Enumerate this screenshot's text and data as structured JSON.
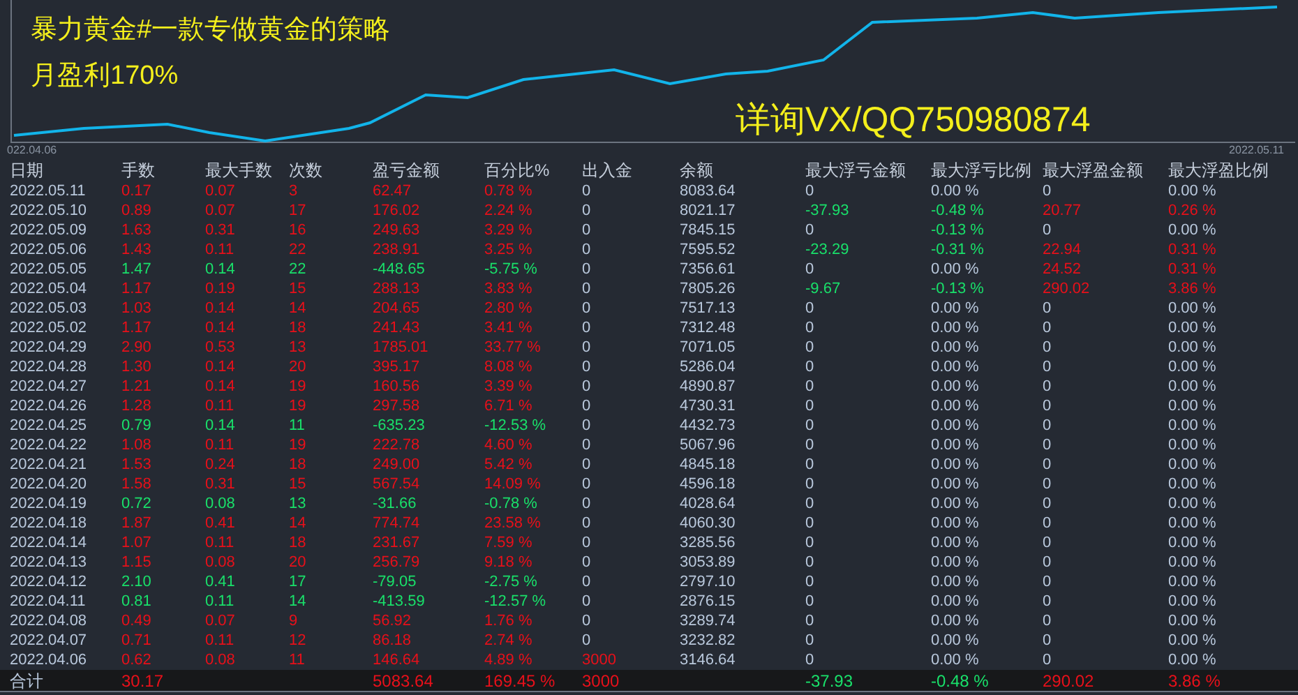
{
  "chart": {
    "title": "暴力黄金#一款专做黄金的策略",
    "subtitle": "月盈利170%",
    "contact": "详询VX/QQ750980874",
    "start_label": "022.04.06",
    "end_label": "2022.05.11"
  },
  "table": {
    "columns": [
      "日期",
      "手数",
      "最大手数",
      "次数",
      "盈亏金额",
      "百分比%",
      "出入金",
      "余额",
      "最大浮亏金额",
      "最大浮亏比例",
      "最大浮盈金额",
      "最大浮盈比例"
    ],
    "rows": [
      {
        "date": "2022.05.11",
        "color": "#e8101a",
        "lots": "0.17",
        "max_lots": "0.07",
        "trades": "3",
        "pnl": "62.47",
        "pct": "0.78 %",
        "cash_flow": {
          "text": "0",
          "color": "#b9c8dc"
        },
        "balance": "8083.64",
        "floats": [
          {
            "text": "0",
            "color": "#b9c8dc"
          },
          {
            "text": "0.00 %",
            "color": "#b9c8dc"
          },
          {
            "text": "0",
            "color": "#b9c8dc"
          },
          {
            "text": "0.00 %",
            "color": "#b9c8dc"
          }
        ]
      },
      {
        "date": "2022.05.10",
        "color": "#e8101a",
        "lots": "0.89",
        "max_lots": "0.07",
        "trades": "17",
        "pnl": "176.02",
        "pct": "2.24 %",
        "cash_flow": {
          "text": "0",
          "color": "#b9c8dc"
        },
        "balance": "8021.17",
        "floats": [
          {
            "text": "-37.93",
            "color": "#19e06a"
          },
          {
            "text": "-0.48 %",
            "color": "#19e06a"
          },
          {
            "text": "20.77",
            "color": "#e8101a"
          },
          {
            "text": "0.26 %",
            "color": "#e8101a"
          }
        ]
      },
      {
        "date": "2022.05.09",
        "color": "#e8101a",
        "lots": "1.63",
        "max_lots": "0.31",
        "trades": "16",
        "pnl": "249.63",
        "pct": "3.29 %",
        "cash_flow": {
          "text": "0",
          "color": "#b9c8dc"
        },
        "balance": "7845.15",
        "floats": [
          {
            "text": "0",
            "color": "#b9c8dc"
          },
          {
            "text": "-0.13 %",
            "color": "#19e06a"
          },
          {
            "text": "0",
            "color": "#b9c8dc"
          },
          {
            "text": "0.00 %",
            "color": "#b9c8dc"
          }
        ]
      },
      {
        "date": "2022.05.06",
        "color": "#e8101a",
        "lots": "1.43",
        "max_lots": "0.11",
        "trades": "22",
        "pnl": "238.91",
        "pct": "3.25 %",
        "cash_flow": {
          "text": "0",
          "color": "#b9c8dc"
        },
        "balance": "7595.52",
        "floats": [
          {
            "text": "-23.29",
            "color": "#19e06a"
          },
          {
            "text": "-0.31 %",
            "color": "#19e06a"
          },
          {
            "text": "22.94",
            "color": "#e8101a"
          },
          {
            "text": "0.31 %",
            "color": "#e8101a"
          }
        ]
      },
      {
        "date": "2022.05.05",
        "color": "#19e06a",
        "lots": "1.47",
        "max_lots": "0.14",
        "trades": "22",
        "pnl": "-448.65",
        "pct": "-5.75 %",
        "cash_flow": {
          "text": "0",
          "color": "#b9c8dc"
        },
        "balance": "7356.61",
        "floats": [
          {
            "text": "0",
            "color": "#b9c8dc"
          },
          {
            "text": "0.00 %",
            "color": "#b9c8dc"
          },
          {
            "text": "24.52",
            "color": "#e8101a"
          },
          {
            "text": "0.31 %",
            "color": "#e8101a"
          }
        ]
      },
      {
        "date": "2022.05.04",
        "color": "#e8101a",
        "lots": "1.17",
        "max_lots": "0.19",
        "trades": "15",
        "pnl": "288.13",
        "pct": "3.83 %",
        "cash_flow": {
          "text": "0",
          "color": "#b9c8dc"
        },
        "balance": "7805.26",
        "floats": [
          {
            "text": "-9.67",
            "color": "#19e06a"
          },
          {
            "text": "-0.13 %",
            "color": "#19e06a"
          },
          {
            "text": "290.02",
            "color": "#e8101a"
          },
          {
            "text": "3.86 %",
            "color": "#e8101a"
          }
        ]
      },
      {
        "date": "2022.05.03",
        "color": "#e8101a",
        "lots": "1.03",
        "max_lots": "0.14",
        "trades": "14",
        "pnl": "204.65",
        "pct": "2.80 %",
        "cash_flow": {
          "text": "0",
          "color": "#b9c8dc"
        },
        "balance": "7517.13",
        "floats": [
          {
            "text": "0",
            "color": "#b9c8dc"
          },
          {
            "text": "0.00 %",
            "color": "#b9c8dc"
          },
          {
            "text": "0",
            "color": "#b9c8dc"
          },
          {
            "text": "0.00 %",
            "color": "#b9c8dc"
          }
        ]
      },
      {
        "date": "2022.05.02",
        "color": "#e8101a",
        "lots": "1.17",
        "max_lots": "0.14",
        "trades": "18",
        "pnl": "241.43",
        "pct": "3.41 %",
        "cash_flow": {
          "text": "0",
          "color": "#b9c8dc"
        },
        "balance": "7312.48",
        "floats": [
          {
            "text": "0",
            "color": "#b9c8dc"
          },
          {
            "text": "0.00 %",
            "color": "#b9c8dc"
          },
          {
            "text": "0",
            "color": "#b9c8dc"
          },
          {
            "text": "0.00 %",
            "color": "#b9c8dc"
          }
        ]
      },
      {
        "date": "2022.04.29",
        "color": "#e8101a",
        "lots": "2.90",
        "max_lots": "0.53",
        "trades": "13",
        "pnl": "1785.01",
        "pct": "33.77 %",
        "cash_flow": {
          "text": "0",
          "color": "#b9c8dc"
        },
        "balance": "7071.05",
        "floats": [
          {
            "text": "0",
            "color": "#b9c8dc"
          },
          {
            "text": "0.00 %",
            "color": "#b9c8dc"
          },
          {
            "text": "0",
            "color": "#b9c8dc"
          },
          {
            "text": "0.00 %",
            "color": "#b9c8dc"
          }
        ]
      },
      {
        "date": "2022.04.28",
        "color": "#e8101a",
        "lots": "1.30",
        "max_lots": "0.14",
        "trades": "20",
        "pnl": "395.17",
        "pct": "8.08 %",
        "cash_flow": {
          "text": "0",
          "color": "#b9c8dc"
        },
        "balance": "5286.04",
        "floats": [
          {
            "text": "0",
            "color": "#b9c8dc"
          },
          {
            "text": "0.00 %",
            "color": "#b9c8dc"
          },
          {
            "text": "0",
            "color": "#b9c8dc"
          },
          {
            "text": "0.00 %",
            "color": "#b9c8dc"
          }
        ]
      },
      {
        "date": "2022.04.27",
        "color": "#e8101a",
        "lots": "1.21",
        "max_lots": "0.14",
        "trades": "19",
        "pnl": "160.56",
        "pct": "3.39 %",
        "cash_flow": {
          "text": "0",
          "color": "#b9c8dc"
        },
        "balance": "4890.87",
        "floats": [
          {
            "text": "0",
            "color": "#b9c8dc"
          },
          {
            "text": "0.00 %",
            "color": "#b9c8dc"
          },
          {
            "text": "0",
            "color": "#b9c8dc"
          },
          {
            "text": "0.00 %",
            "color": "#b9c8dc"
          }
        ]
      },
      {
        "date": "2022.04.26",
        "color": "#e8101a",
        "lots": "1.28",
        "max_lots": "0.11",
        "trades": "19",
        "pnl": "297.58",
        "pct": "6.71 %",
        "cash_flow": {
          "text": "0",
          "color": "#b9c8dc"
        },
        "balance": "4730.31",
        "floats": [
          {
            "text": "0",
            "color": "#b9c8dc"
          },
          {
            "text": "0.00 %",
            "color": "#b9c8dc"
          },
          {
            "text": "0",
            "color": "#b9c8dc"
          },
          {
            "text": "0.00 %",
            "color": "#b9c8dc"
          }
        ]
      },
      {
        "date": "2022.04.25",
        "color": "#19e06a",
        "lots": "0.79",
        "max_lots": "0.14",
        "trades": "11",
        "pnl": "-635.23",
        "pct": "-12.53 %",
        "cash_flow": {
          "text": "0",
          "color": "#b9c8dc"
        },
        "balance": "4432.73",
        "floats": [
          {
            "text": "0",
            "color": "#b9c8dc"
          },
          {
            "text": "0.00 %",
            "color": "#b9c8dc"
          },
          {
            "text": "0",
            "color": "#b9c8dc"
          },
          {
            "text": "0.00 %",
            "color": "#b9c8dc"
          }
        ]
      },
      {
        "date": "2022.04.22",
        "color": "#e8101a",
        "lots": "1.08",
        "max_lots": "0.11",
        "trades": "19",
        "pnl": "222.78",
        "pct": "4.60 %",
        "cash_flow": {
          "text": "0",
          "color": "#b9c8dc"
        },
        "balance": "5067.96",
        "floats": [
          {
            "text": "0",
            "color": "#b9c8dc"
          },
          {
            "text": "0.00 %",
            "color": "#b9c8dc"
          },
          {
            "text": "0",
            "color": "#b9c8dc"
          },
          {
            "text": "0.00 %",
            "color": "#b9c8dc"
          }
        ]
      },
      {
        "date": "2022.04.21",
        "color": "#e8101a",
        "lots": "1.53",
        "max_lots": "0.24",
        "trades": "18",
        "pnl": "249.00",
        "pct": "5.42 %",
        "cash_flow": {
          "text": "0",
          "color": "#b9c8dc"
        },
        "balance": "4845.18",
        "floats": [
          {
            "text": "0",
            "color": "#b9c8dc"
          },
          {
            "text": "0.00 %",
            "color": "#b9c8dc"
          },
          {
            "text": "0",
            "color": "#b9c8dc"
          },
          {
            "text": "0.00 %",
            "color": "#b9c8dc"
          }
        ]
      },
      {
        "date": "2022.04.20",
        "color": "#e8101a",
        "lots": "1.58",
        "max_lots": "0.31",
        "trades": "15",
        "pnl": "567.54",
        "pct": "14.09 %",
        "cash_flow": {
          "text": "0",
          "color": "#b9c8dc"
        },
        "balance": "4596.18",
        "floats": [
          {
            "text": "0",
            "color": "#b9c8dc"
          },
          {
            "text": "0.00 %",
            "color": "#b9c8dc"
          },
          {
            "text": "0",
            "color": "#b9c8dc"
          },
          {
            "text": "0.00 %",
            "color": "#b9c8dc"
          }
        ]
      },
      {
        "date": "2022.04.19",
        "color": "#19e06a",
        "lots": "0.72",
        "max_lots": "0.08",
        "trades": "13",
        "pnl": "-31.66",
        "pct": "-0.78 %",
        "cash_flow": {
          "text": "0",
          "color": "#b9c8dc"
        },
        "balance": "4028.64",
        "floats": [
          {
            "text": "0",
            "color": "#b9c8dc"
          },
          {
            "text": "0.00 %",
            "color": "#b9c8dc"
          },
          {
            "text": "0",
            "color": "#b9c8dc"
          },
          {
            "text": "0.00 %",
            "color": "#b9c8dc"
          }
        ]
      },
      {
        "date": "2022.04.18",
        "color": "#e8101a",
        "lots": "1.87",
        "max_lots": "0.41",
        "trades": "14",
        "pnl": "774.74",
        "pct": "23.58 %",
        "cash_flow": {
          "text": "0",
          "color": "#b9c8dc"
        },
        "balance": "4060.30",
        "floats": [
          {
            "text": "0",
            "color": "#b9c8dc"
          },
          {
            "text": "0.00 %",
            "color": "#b9c8dc"
          },
          {
            "text": "0",
            "color": "#b9c8dc"
          },
          {
            "text": "0.00 %",
            "color": "#b9c8dc"
          }
        ]
      },
      {
        "date": "2022.04.14",
        "color": "#e8101a",
        "lots": "1.07",
        "max_lots": "0.11",
        "trades": "18",
        "pnl": "231.67",
        "pct": "7.59 %",
        "cash_flow": {
          "text": "0",
          "color": "#b9c8dc"
        },
        "balance": "3285.56",
        "floats": [
          {
            "text": "0",
            "color": "#b9c8dc"
          },
          {
            "text": "0.00 %",
            "color": "#b9c8dc"
          },
          {
            "text": "0",
            "color": "#b9c8dc"
          },
          {
            "text": "0.00 %",
            "color": "#b9c8dc"
          }
        ]
      },
      {
        "date": "2022.04.13",
        "color": "#e8101a",
        "lots": "1.15",
        "max_lots": "0.08",
        "trades": "20",
        "pnl": "256.79",
        "pct": "9.18 %",
        "cash_flow": {
          "text": "0",
          "color": "#b9c8dc"
        },
        "balance": "3053.89",
        "floats": [
          {
            "text": "0",
            "color": "#b9c8dc"
          },
          {
            "text": "0.00 %",
            "color": "#b9c8dc"
          },
          {
            "text": "0",
            "color": "#b9c8dc"
          },
          {
            "text": "0.00 %",
            "color": "#b9c8dc"
          }
        ]
      },
      {
        "date": "2022.04.12",
        "color": "#19e06a",
        "lots": "2.10",
        "max_lots": "0.41",
        "trades": "17",
        "pnl": "-79.05",
        "pct": "-2.75 %",
        "cash_flow": {
          "text": "0",
          "color": "#b9c8dc"
        },
        "balance": "2797.10",
        "floats": [
          {
            "text": "0",
            "color": "#b9c8dc"
          },
          {
            "text": "0.00 %",
            "color": "#b9c8dc"
          },
          {
            "text": "0",
            "color": "#b9c8dc"
          },
          {
            "text": "0.00 %",
            "color": "#b9c8dc"
          }
        ]
      },
      {
        "date": "2022.04.11",
        "color": "#19e06a",
        "lots": "0.81",
        "max_lots": "0.11",
        "trades": "14",
        "pnl": "-413.59",
        "pct": "-12.57 %",
        "cash_flow": {
          "text": "0",
          "color": "#b9c8dc"
        },
        "balance": "2876.15",
        "floats": [
          {
            "text": "0",
            "color": "#b9c8dc"
          },
          {
            "text": "0.00 %",
            "color": "#b9c8dc"
          },
          {
            "text": "0",
            "color": "#b9c8dc"
          },
          {
            "text": "0.00 %",
            "color": "#b9c8dc"
          }
        ]
      },
      {
        "date": "2022.04.08",
        "color": "#e8101a",
        "lots": "0.49",
        "max_lots": "0.07",
        "trades": "9",
        "pnl": "56.92",
        "pct": "1.76 %",
        "cash_flow": {
          "text": "0",
          "color": "#b9c8dc"
        },
        "balance": "3289.74",
        "floats": [
          {
            "text": "0",
            "color": "#b9c8dc"
          },
          {
            "text": "0.00 %",
            "color": "#b9c8dc"
          },
          {
            "text": "0",
            "color": "#b9c8dc"
          },
          {
            "text": "0.00 %",
            "color": "#b9c8dc"
          }
        ]
      },
      {
        "date": "2022.04.07",
        "color": "#e8101a",
        "lots": "0.71",
        "max_lots": "0.11",
        "trades": "12",
        "pnl": "86.18",
        "pct": "2.74 %",
        "cash_flow": {
          "text": "0",
          "color": "#b9c8dc"
        },
        "balance": "3232.82",
        "floats": [
          {
            "text": "0",
            "color": "#b9c8dc"
          },
          {
            "text": "0.00 %",
            "color": "#b9c8dc"
          },
          {
            "text": "0",
            "color": "#b9c8dc"
          },
          {
            "text": "0.00 %",
            "color": "#b9c8dc"
          }
        ]
      },
      {
        "date": "2022.04.06",
        "color": "#e8101a",
        "lots": "0.62",
        "max_lots": "0.08",
        "trades": "11",
        "pnl": "146.64",
        "pct": "4.89 %",
        "cash_flow": {
          "text": "3000",
          "color": "#e8101a"
        },
        "balance": "3146.64",
        "floats": [
          {
            "text": "0",
            "color": "#b9c8dc"
          },
          {
            "text": "0.00 %",
            "color": "#b9c8dc"
          },
          {
            "text": "0",
            "color": "#b9c8dc"
          },
          {
            "text": "0.00 %",
            "color": "#b9c8dc"
          }
        ]
      }
    ],
    "total": {
      "label": "合计",
      "color": "#e8101a",
      "lots": "30.17",
      "pnl": "5083.64",
      "pct": "169.45 %",
      "cash_flow": {
        "text": "3000",
        "color": "#e8101a"
      },
      "floats": [
        {
          "text": "-37.93",
          "color": "#19e06a"
        },
        {
          "text": "-0.48 %",
          "color": "#19e06a"
        },
        {
          "text": "290.02",
          "color": "#e8101a"
        },
        {
          "text": "3.86 %",
          "color": "#e8101a"
        }
      ]
    }
  }
}
